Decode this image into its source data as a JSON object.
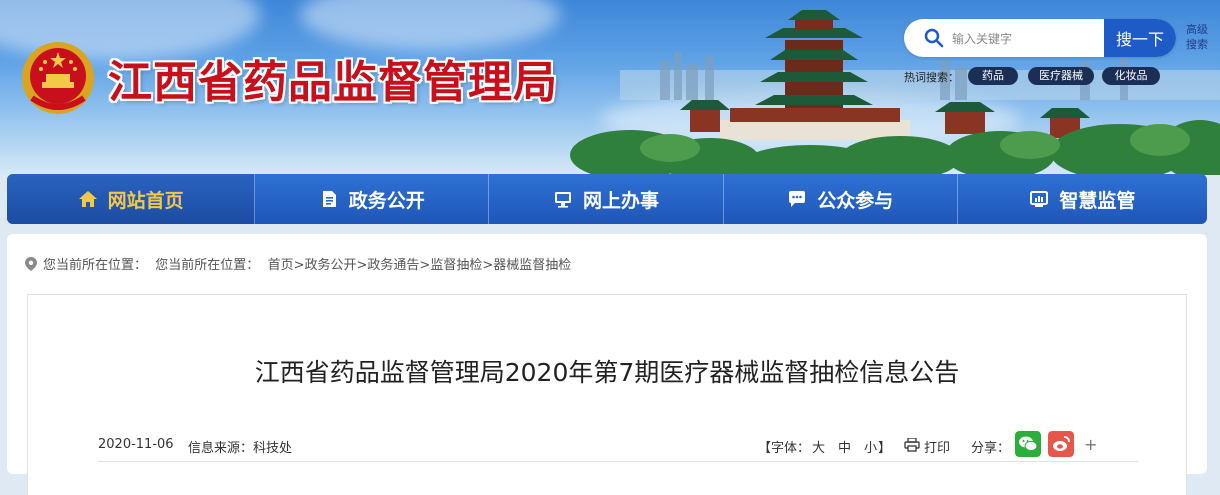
{
  "header": {
    "site_title": "江西省药品监督管理局",
    "search": {
      "placeholder": "输入关键字",
      "button_label": "搜一下",
      "advanced_label": "高级搜索"
    },
    "hotwords": {
      "label": "热词搜索：",
      "tags": [
        "药品",
        "医疗器械",
        "化妆品"
      ]
    },
    "colors": {
      "title_red": "#c8101c",
      "search_blue": "#1e5bc6",
      "tag_dark": "#1b2f55"
    }
  },
  "nav": {
    "items": [
      {
        "label": "网站首页",
        "icon": "home-icon",
        "active": true
      },
      {
        "label": "政务公开",
        "icon": "document-icon",
        "active": false
      },
      {
        "label": "网上办事",
        "icon": "monitor-icon",
        "active": false
      },
      {
        "label": "公众参与",
        "icon": "chat-icon",
        "active": false
      },
      {
        "label": "智慧监管",
        "icon": "dashboard-icon",
        "active": false
      }
    ],
    "colors": {
      "bar": "#2a66cc",
      "active_text": "#f2c84b"
    }
  },
  "breadcrumb": {
    "prefix": "您当前所在位置：",
    "prefix2": "您当前所在位置：",
    "items": [
      "首页",
      "政务公开",
      "政务通告",
      "监督抽检",
      "器械监督抽检"
    ],
    "separator": ">"
  },
  "article": {
    "title": "江西省药品监督管理局2020年第7期医疗器械监督抽检信息公告",
    "date": "2020-11-06",
    "source_label": "信息来源：",
    "source": "科技处",
    "font_label": "【字体：",
    "font_sizes": [
      "大",
      "中",
      "小"
    ],
    "font_close": "】",
    "print_label": "打印",
    "share_label": "分享：",
    "share_icons": [
      "wechat-icon",
      "weibo-icon"
    ],
    "more_label": "+",
    "colors": {
      "wechat": "#2aae3c",
      "weibo": "#e5574a"
    }
  }
}
